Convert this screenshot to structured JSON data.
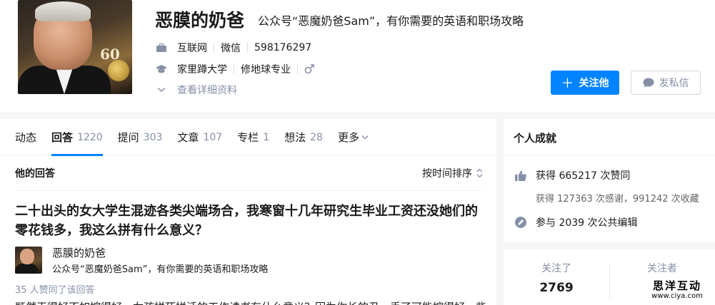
{
  "profile": {
    "name": "恶膜的奶爸",
    "headline": "公众号“恶魔奶爸Sam”，有你需要的英语和职场攻略",
    "work": {
      "industry": "互联网",
      "company": "微信",
      "title": "598176297"
    },
    "education": {
      "school": "家里蹲大学",
      "major": "修地球专业",
      "gender_icon": "male-icon"
    },
    "more_label": "查看详细资料",
    "follow_label": "关注他",
    "message_label": "发私信"
  },
  "tabs": [
    {
      "label": "动态",
      "count": ""
    },
    {
      "label": "回答",
      "count": "1220"
    },
    {
      "label": "提问",
      "count": "303"
    },
    {
      "label": "文章",
      "count": "107"
    },
    {
      "label": "专栏",
      "count": "1"
    },
    {
      "label": "想法",
      "count": "28"
    },
    {
      "label": "更多",
      "count": ""
    }
  ],
  "answers": {
    "title": "他的回答",
    "sort_label": "按时间排序",
    "item": {
      "question": "二十出头的女大学生混迹各类尖端场合，我寒窗十几年研究生毕业工资还没她们的零花钱多，我这么拼有什么意义？",
      "author_name": "恶膜的奶爸",
      "author_headline": "公众号“恶魔奶爸Sam”，有你需要的英语和职场攻略",
      "votes": "35 人赞同了该回答",
      "excerpt": "既然干得好不如嫁得好，女孩拼死拼活的工作读书有什么意义？因为你长的丑，丢了可能嫁得好一些"
    }
  },
  "achievements": {
    "title": "个人成就",
    "approvals": "获得 665217 次赞同",
    "thanks_favorites": "获得 127363 次感谢，991242 次收藏",
    "edits": "参与 2039 次公共编辑"
  },
  "follow": {
    "following_label": "关注了",
    "following_count": "2769",
    "followers_label": "关注者"
  },
  "watermark": {
    "title": "思洋互动",
    "url": "www.ciya.com"
  },
  "colors": {
    "accent": "#0084ff",
    "muted": "#8590a6"
  }
}
